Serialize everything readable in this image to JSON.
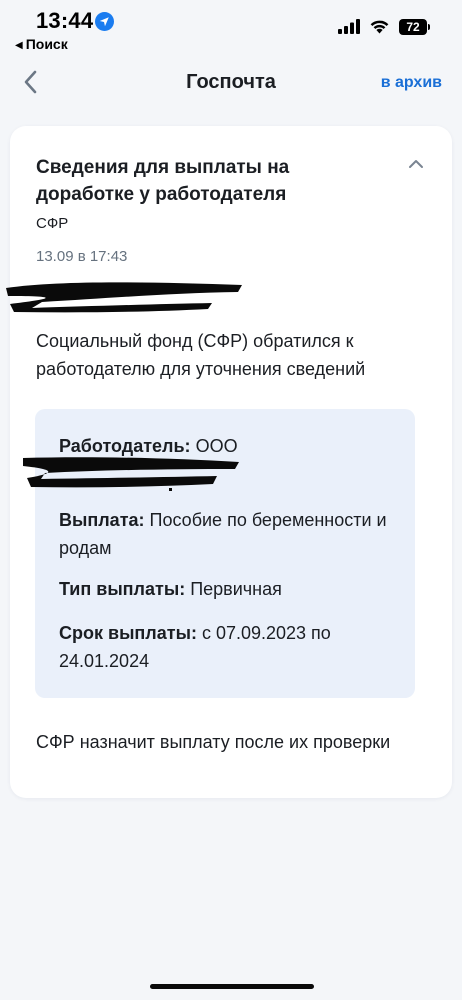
{
  "status_bar": {
    "time": "13:44",
    "back_app_label": "Поиск",
    "battery_level": "72"
  },
  "header": {
    "title": "Госпочта",
    "archive_label": "в архив"
  },
  "message": {
    "title": "Сведения для выплаты на доработке у работодателя",
    "sender": "СФР",
    "date": "13.09 в 17:43",
    "body": "Социальный фонд (СФР) обратился к работодателю для уточнения сведений",
    "details": {
      "employer_label": "Работодатель:",
      "employer_value": "ООО",
      "payment_label": "Выплата:",
      "payment_value": "Пособие по беременности и родам",
      "type_label": "Тип выплаты:",
      "type_value": "Первичная",
      "period_label": "Срок выплаты:",
      "period_value": "с 07.09.2023 по 24.01.2024"
    },
    "footer": "СФР назначит выплату после их проверки"
  },
  "colors": {
    "accent": "#1a6fd6",
    "background": "#f4f6f9",
    "info_box": "#eaf0fa",
    "muted_text": "#66727f"
  }
}
